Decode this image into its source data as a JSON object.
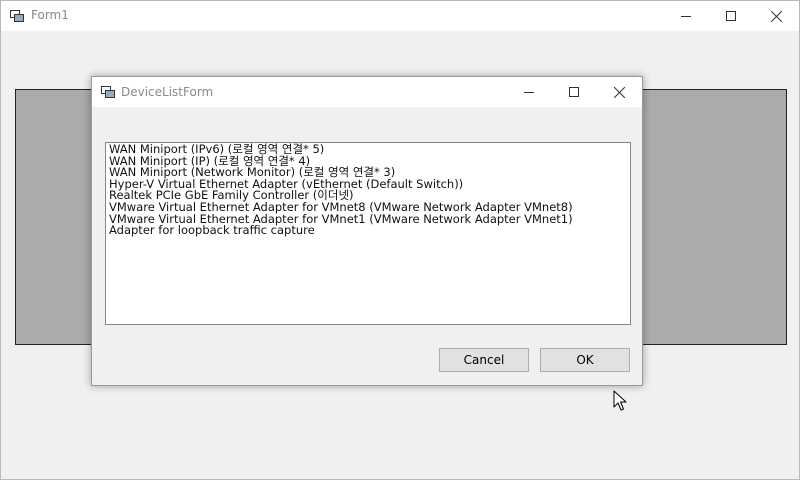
{
  "main_window": {
    "title": "Form1",
    "icon": "form-icon"
  },
  "dialog": {
    "title": "DeviceListForm",
    "icon": "form-icon",
    "devices": [
      "WAN Miniport (IPv6) (로컬 영역 연결* 5)",
      "WAN Miniport (IP) (로컬 영역 연결* 4)",
      "WAN Miniport (Network Monitor) (로컬 영역 연결* 3)",
      "Hyper-V Virtual Ethernet Adapter (vEthernet (Default Switch))",
      "Realtek PCIe GbE Family Controller (이더넷)",
      "VMware Virtual Ethernet Adapter for VMnet8 (VMware Network Adapter VMnet8)",
      "VMware Virtual Ethernet Adapter for VMnet1 (VMware Network Adapter VMnet1)",
      "Adapter for loopback traffic capture"
    ],
    "cancel_label": "Cancel",
    "ok_label": "OK"
  },
  "colors": {
    "panel_gray": "#ababab",
    "window_bg": "#f0f0f0",
    "titlebar_bg": "#ffffff"
  }
}
